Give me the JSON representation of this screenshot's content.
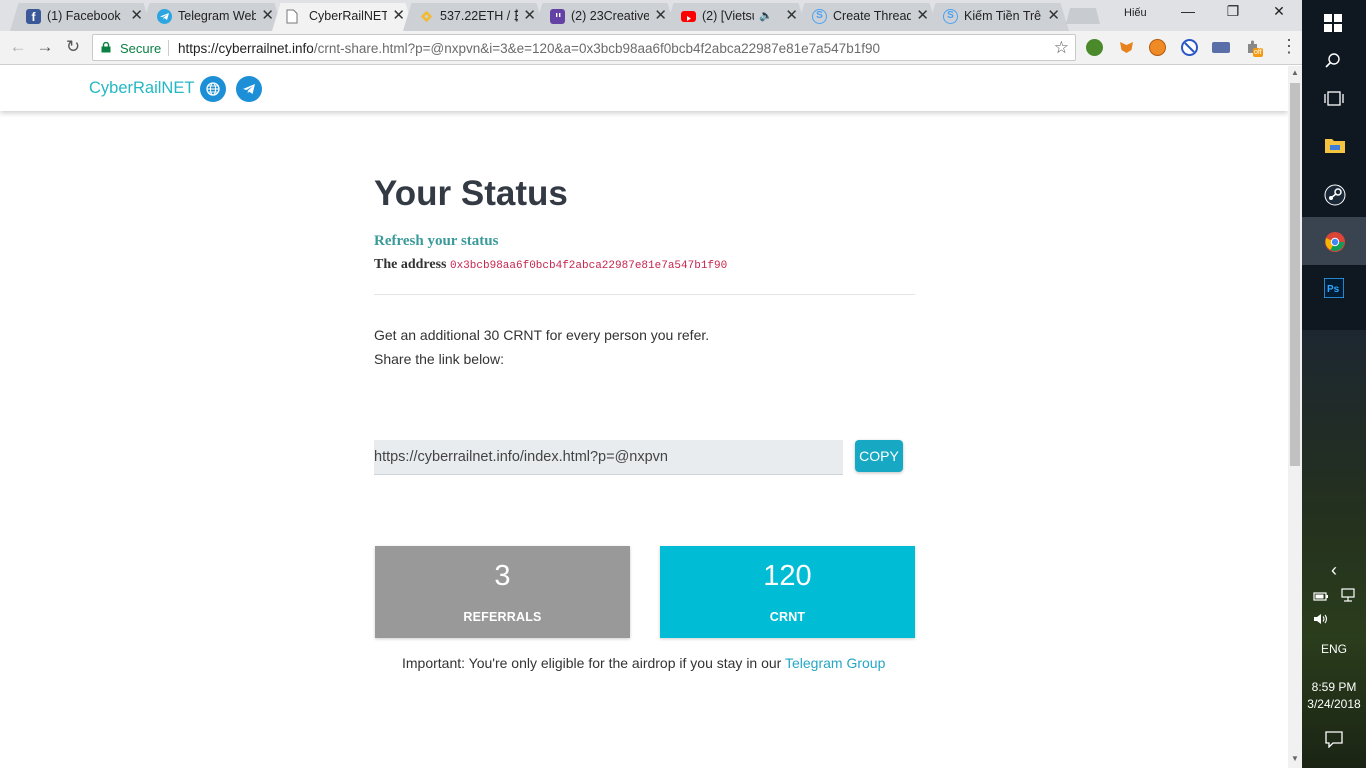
{
  "browser": {
    "tabs": [
      {
        "title": "(1) Facebook",
        "icon": "facebook-icon",
        "color": "#3b5998",
        "active": false
      },
      {
        "title": "Telegram Web",
        "icon": "telegram-icon",
        "color": "#2ca5e0",
        "active": false
      },
      {
        "title": "CyberRailNET",
        "icon": "page-icon",
        "color": "#ffffff",
        "active": true
      },
      {
        "title": "537.22ETH / ₿",
        "icon": "binance-icon",
        "color": "#f3ba2f",
        "active": false
      },
      {
        "title": "(2) 23Creative",
        "icon": "twitch-icon",
        "color": "#6441a5",
        "active": false
      },
      {
        "title": "(2) [Vietsub",
        "icon": "youtube-icon",
        "color": "#ff0000",
        "active": false
      },
      {
        "title": "Create Thread",
        "icon": "steemit-icon",
        "color": "#4ba2f2",
        "active": false
      },
      {
        "title": "Kiếm Tiền Trê",
        "icon": "steemit-icon",
        "color": "#4ba2f2",
        "active": false
      }
    ],
    "tab_close_glyph": "✕",
    "profile_name": "Hiếu",
    "window_controls": {
      "minimize": "—",
      "restore": "❐",
      "close": "✕"
    },
    "nav": {
      "back": "←",
      "forward": "→",
      "reload": "↻"
    },
    "secure_label": "Secure",
    "url_host": "https://cyberrailnet.info",
    "url_rest": "/crnt-share.html?p=@nxpvn&i=3&e=120&a=0x3bcb98aa6f0bcb4f2abca22987e81e7a547b1f90",
    "star_glyph": "☆",
    "menu_glyph": "⋮",
    "extension_badge": "off"
  },
  "site": {
    "brand": "CyberRailNET",
    "accent_color": "#24b8c4"
  },
  "status": {
    "title": "Your Status",
    "refresh_link": "Refresh your status",
    "address_label": "The address",
    "address_value": "0x3bcb98aa6f0bcb4f2abca22987e81e7a547b1f90",
    "refer_text": "Get an additional 30 CRNT for every person you refer.",
    "share_text": "Share the link below:",
    "share_link": "https://cyberrailnet.info/index.html?p=@nxpvn",
    "copy_label": "COPY",
    "referrals_value": "3",
    "referrals_label": "REFERRALS",
    "crnt_value": "120",
    "crnt_label": "CRNT",
    "note_text": "Important: You're only eligible for the airdrop if you stay in our ",
    "note_link": "Telegram Group"
  },
  "taskbar": {
    "language": "ENG",
    "time": "8:59 PM",
    "date": "3/24/2018",
    "chevron": "‹"
  }
}
